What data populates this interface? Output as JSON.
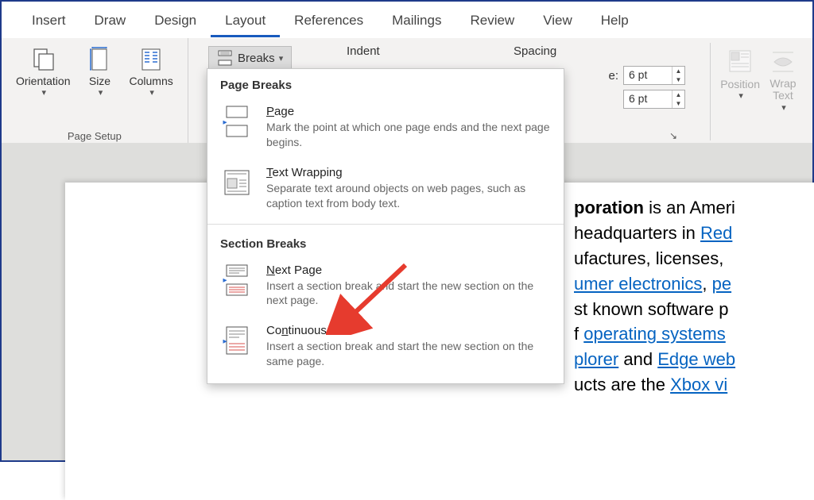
{
  "tabs": [
    "Insert",
    "Draw",
    "Design",
    "Layout",
    "References",
    "Mailings",
    "Review",
    "View",
    "Help"
  ],
  "active_tab_index": 3,
  "ribbon": {
    "page_setup": {
      "orientation": "Orientation",
      "size": "Size",
      "columns": "Columns",
      "group_label": "Page Setup",
      "breaks_label": "Breaks"
    },
    "indent_label": "Indent",
    "spacing_label": "Spacing",
    "spacing_before_prefix": "e:",
    "spacing_before": "6 pt",
    "spacing_after": "6 pt",
    "arrange": {
      "position": "Position",
      "wrap_text": "Wrap\nText"
    }
  },
  "dropdown": {
    "section1": "Page Breaks",
    "items1": [
      {
        "title_prefix": "P",
        "title_rest": "age",
        "desc": "Mark the point at which one page ends and the next page begins."
      },
      {
        "title_prefix": "T",
        "title_rest": "ext Wrapping",
        "desc": "Separate text around objects on web pages, such as caption text from body text."
      }
    ],
    "section2": "Section Breaks",
    "items2": [
      {
        "title_prefix": "N",
        "title_rest": "ext Page",
        "desc": "Insert a section break and start the new section on the next page."
      },
      {
        "title_prefix": "Co",
        "title_mid": "n",
        "title_rest": "tinuous",
        "desc": "Insert a section break and start the new section on the same page."
      }
    ]
  },
  "document": {
    "line1_bold": "poration",
    "line1_rest": " is an Ameri",
    "line2_plain": "headquarters in ",
    "line2_link": "Red",
    "line3_plain": "ufactures, licenses, ",
    "line4_link": "umer electronics",
    "line4_plain": ", ",
    "line4_link2": "pe",
    "line5_plain": "st known software p",
    "line6_plain": "f ",
    "line6_link": "operating systems",
    "line7_link1": "plorer",
    "line7_mid": " and ",
    "line7_link2": "Edge",
    "line7_link3": " web",
    "line8_plain": "ucts are the ",
    "line8_link": "Xbox vi"
  }
}
